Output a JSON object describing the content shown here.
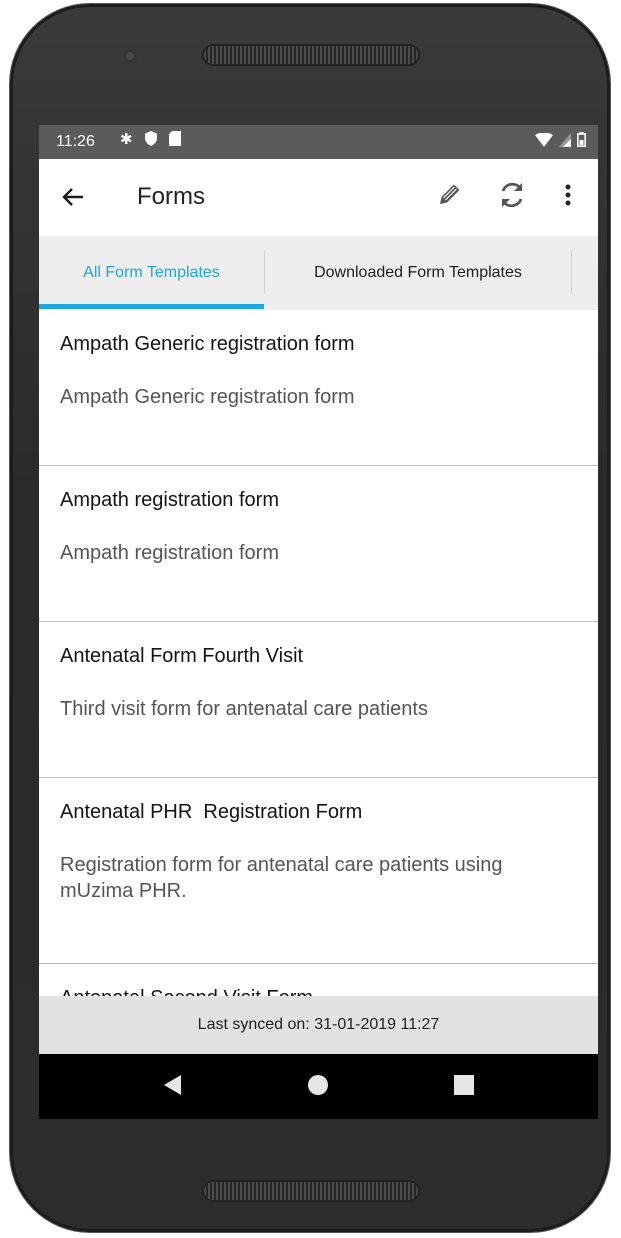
{
  "status_bar": {
    "time": "11:26",
    "left_icons": [
      "settings-icon",
      "shield-icon",
      "sd-card-icon"
    ],
    "right_icons": [
      "wifi-icon",
      "signal-icon",
      "battery-icon"
    ]
  },
  "app_bar": {
    "title": "Forms",
    "back_icon": "arrow-left-icon",
    "actions": [
      "edit-pencil-icon",
      "sync-icon",
      "more-vert-icon"
    ]
  },
  "tabs": [
    {
      "label": "All Form Templates",
      "selected": true
    },
    {
      "label": "Downloaded Form Templates",
      "selected": false
    }
  ],
  "forms": [
    {
      "name": "Ampath Generic registration form",
      "description": "Ampath Generic registration form"
    },
    {
      "name": "Ampath registration form",
      "description": "Ampath registration form"
    },
    {
      "name": "Antenatal Form Fourth Visit",
      "description": "Third visit form for antenatal care patients"
    },
    {
      "name": "Antenatal PHR  Registration Form",
      "description": "Registration form for antenatal care patients using mUzima PHR."
    },
    {
      "name": "Antenatal Second Visit Form",
      "description": ""
    }
  ],
  "footer": {
    "last_synced": "Last synced on: 31-01-2019 11:27"
  },
  "colors": {
    "accent": "#1ea7e0",
    "status_bar": "#5b5b5b",
    "tab_bar": "#eeeeee",
    "footer": "#e2e2e2"
  }
}
